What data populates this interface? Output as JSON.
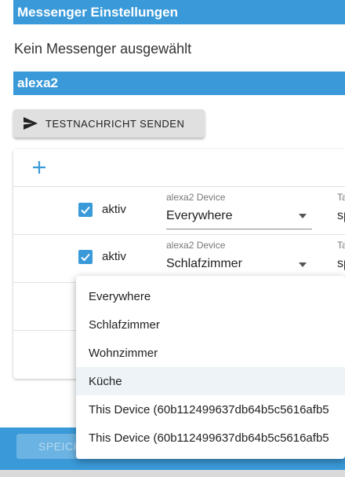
{
  "header": {
    "title": "Messenger Einstellungen"
  },
  "status": {
    "no_messenger": "Kein Messenger ausgewählt"
  },
  "section": {
    "name": "alexa2"
  },
  "test_button": {
    "label": "TESTNACHRICHT SENDEN"
  },
  "table": {
    "rows": [
      {
        "checked": true,
        "active_label": "aktiv",
        "device_label": "alexa2 Device",
        "device_value": "Everywhere",
        "cut_label": "Ta",
        "cut_value": "sp"
      },
      {
        "checked": true,
        "active_label": "aktiv",
        "device_label": "alexa2 Device",
        "device_value": "Schlafzimmer",
        "cut_label": "Ta",
        "cut_value": "sp"
      }
    ]
  },
  "dropdown": {
    "options": [
      "Everywhere",
      "Schlafzimmer",
      "Wohnzimmer",
      "Küche",
      "This Device (60b112499637db64b5c5616afb5",
      "This Device (60b112499637db64b5c5616afb5"
    ],
    "highlighted": "Küche"
  },
  "footer": {
    "save_label": "SPEICHERN"
  },
  "colors": {
    "accent": "#3a9ad9",
    "button_bg": "#e0e0e0",
    "hover": "#edf3f7"
  }
}
